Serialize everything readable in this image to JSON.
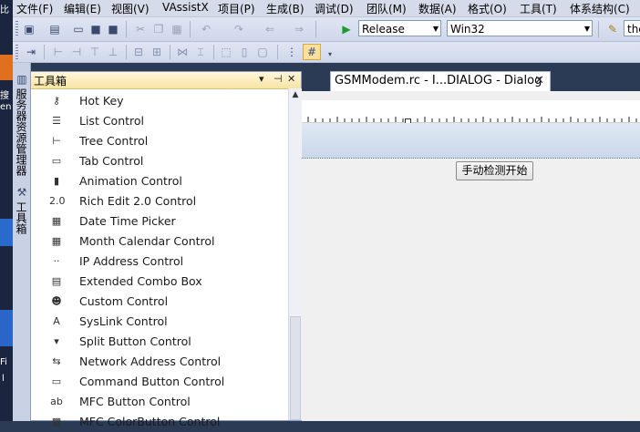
{
  "menu": [
    "文件(F)",
    "编辑(E)",
    "视图(V)",
    "VAssistX",
    "项目(P)",
    "生成(B)",
    "调试(D)",
    "团队(M)",
    "数据(A)",
    "格式(O)",
    "工具(T)",
    "体系结构(C)"
  ],
  "toolbar": {
    "config_combo": "Release",
    "platform_combo": "Win32",
    "find_combo": "the"
  },
  "side_tabs": [
    "服务器资源管理器",
    "工具箱"
  ],
  "toolbox": {
    "title": "工具箱",
    "items": [
      {
        "label": "Hot Key",
        "icon": "hotkey-icon"
      },
      {
        "label": "List Control",
        "icon": "list-control-icon"
      },
      {
        "label": "Tree Control",
        "icon": "tree-control-icon"
      },
      {
        "label": "Tab Control",
        "icon": "tab-control-icon"
      },
      {
        "label": "Animation Control",
        "icon": "animation-control-icon"
      },
      {
        "label": "Rich Edit 2.0 Control",
        "icon": "rich-edit-icon"
      },
      {
        "label": "Date Time Picker",
        "icon": "date-time-picker-icon"
      },
      {
        "label": "Month Calendar Control",
        "icon": "month-calendar-icon"
      },
      {
        "label": "IP Address Control",
        "icon": "ip-address-icon"
      },
      {
        "label": "Extended Combo Box",
        "icon": "extended-combo-icon"
      },
      {
        "label": "Custom Control",
        "icon": "custom-control-icon"
      },
      {
        "label": "SysLink Control",
        "icon": "syslink-icon"
      },
      {
        "label": "Split Button Control",
        "icon": "split-button-icon"
      },
      {
        "label": "Network Address Control",
        "icon": "network-address-icon"
      },
      {
        "label": "Command Button Control",
        "icon": "command-button-icon"
      },
      {
        "label": "MFC Button Control",
        "icon": "mfc-button-icon"
      },
      {
        "label": "MFC ColorButton Control",
        "icon": "mfc-colorbutton-icon"
      }
    ]
  },
  "document": {
    "tab_title": "GSMModem.rc - I...DIALOG - Dialog",
    "button_label": "手动检测开始"
  },
  "desktop_glyphs": [
    "比",
    "搜",
    "en",
    "Fi",
    "l"
  ]
}
